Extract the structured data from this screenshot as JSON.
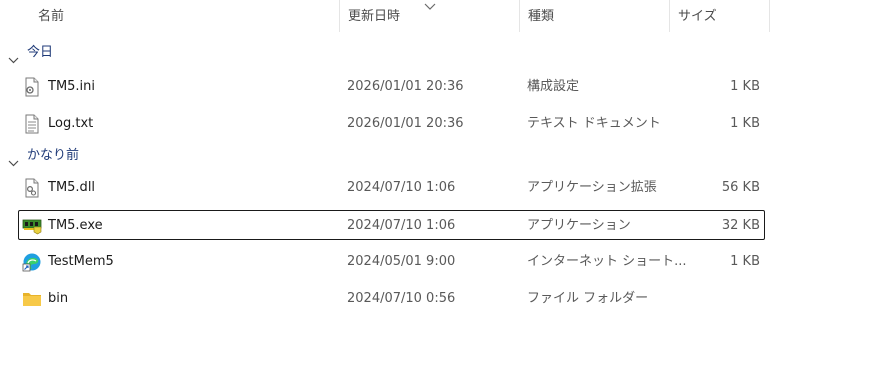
{
  "header": {
    "name": "名前",
    "date": "更新日時",
    "type": "種類",
    "size": "サイズ",
    "sort_icon": "chevron-down-icon"
  },
  "groups": [
    {
      "label": "今日",
      "icon": "chevron-down-icon"
    },
    {
      "label": "かなり前",
      "icon": "chevron-down-icon"
    }
  ],
  "files": [
    {
      "name": "TM5.ini",
      "date": "2026/01/01 20:36",
      "type": "構成設定",
      "size": "1 KB",
      "icon": "settings-file-icon"
    },
    {
      "name": "Log.txt",
      "date": "2026/01/01 20:36",
      "type": "テキスト ドキュメント",
      "size": "1 KB",
      "icon": "text-file-icon"
    },
    {
      "name": "TM5.dll",
      "date": "2024/07/10 1:06",
      "type": "アプリケーション拡張",
      "size": "56 KB",
      "icon": "dll-file-icon"
    },
    {
      "name": "TM5.exe",
      "date": "2024/07/10 1:06",
      "type": "アプリケーション",
      "size": "32 KB",
      "icon": "memory-app-icon",
      "selected": true
    },
    {
      "name": "TestMem5",
      "date": "2024/05/01 9:00",
      "type": "インターネット ショート...",
      "size": "1 KB",
      "icon": "edge-shortcut-icon"
    },
    {
      "name": "bin",
      "date": "2024/07/10 0:56",
      "type": "ファイル フォルダー",
      "size": "",
      "icon": "folder-icon"
    }
  ],
  "colors": {
    "group_label": "#1f3a78",
    "selection_border": "#1a1a1a",
    "folder": "#f5c542"
  }
}
